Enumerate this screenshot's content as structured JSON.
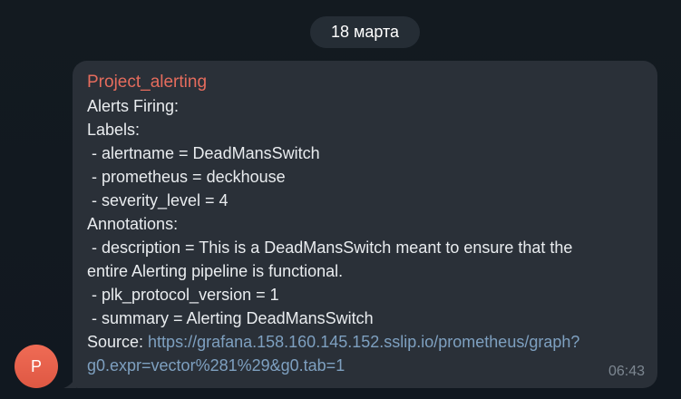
{
  "date_separator": "18 марта",
  "avatar": {
    "initial": "P",
    "color": "#e5624d"
  },
  "message": {
    "sender": "Project_alerting",
    "sender_color": "#e56c5d",
    "lines": [
      "Alerts Firing:",
      "Labels:",
      " - alertname = DeadMansSwitch",
      " - prometheus = deckhouse",
      " - severity_level = 4",
      "Annotations:",
      " - description = This is a DeadMansSwitch meant to ensure that the",
      "entire Alerting pipeline is functional.",
      " - plk_protocol_version = 1",
      " - summary = Alerting DeadMansSwitch"
    ],
    "source_label": "Source: ",
    "source_link_part1": "https://grafana.158.160.145.152.sslip.io/prometheus/graph?",
    "source_link_part2": "g0.expr=vector%281%29&g0.tab=1",
    "time": "06:43"
  },
  "colors": {
    "background": "#121920",
    "bubble": "#2a3038",
    "link": "#7ea0c0",
    "text": "#e9ecef"
  }
}
